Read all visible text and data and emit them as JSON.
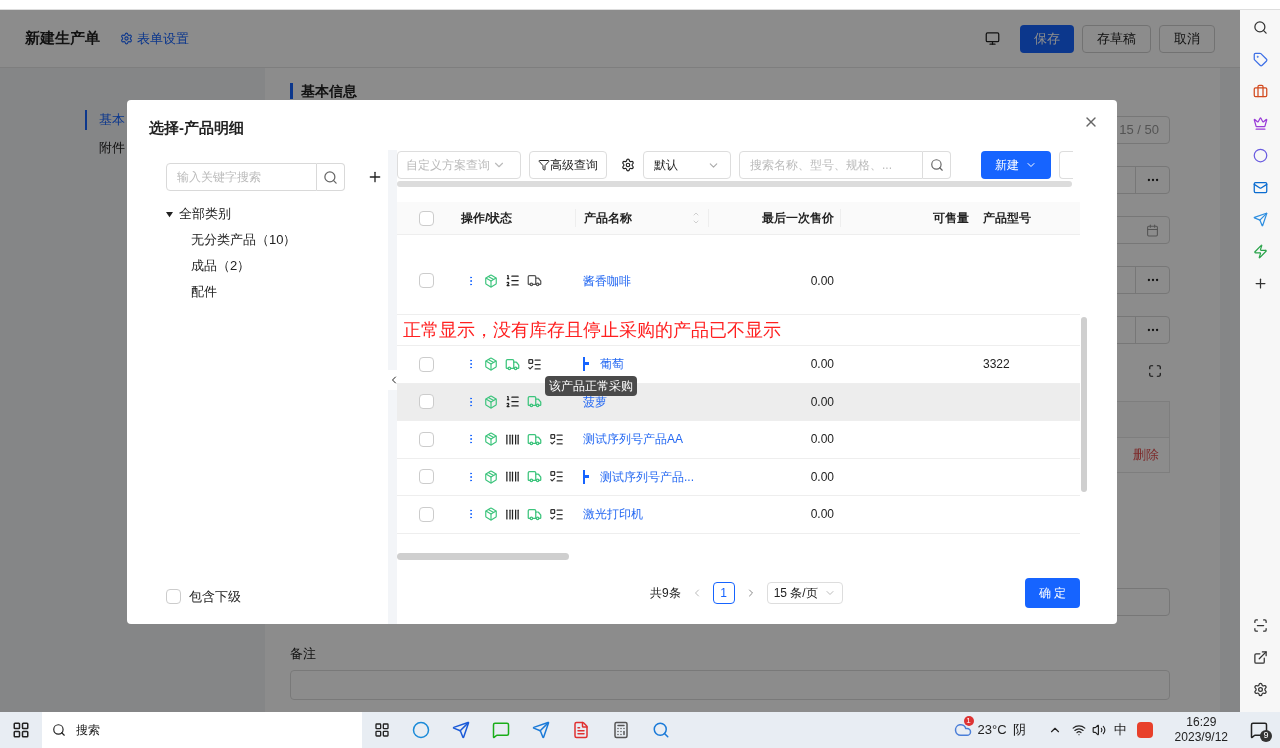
{
  "app": {
    "title": "新建生产单",
    "form_settings": "表单设置",
    "actions": [
      {
        "label": "保存",
        "primary": true
      },
      {
        "label": "存草稿",
        "primary": false
      },
      {
        "label": "取消",
        "primary": false
      }
    ],
    "nav": [
      {
        "label": "基本",
        "selected": true
      },
      {
        "label": "附件",
        "selected": false
      }
    ],
    "section_title": "基本信息",
    "counter": "15 / 50",
    "delete_link": "删除",
    "remark_label": "备注"
  },
  "dialog": {
    "title": "选择-产品明细",
    "tree_search_placeholder": "输入关键字搜索",
    "tree": [
      {
        "label": "全部类别",
        "expanded": true,
        "children": [
          {
            "label": "无分类产品（10）"
          },
          {
            "label": "成品（2）"
          },
          {
            "label": "配件"
          }
        ]
      }
    ],
    "include_sub": {
      "label": "包含下级",
      "checked": false
    },
    "toolbar": {
      "scheme_placeholder": "自定义方案查询",
      "advanced": "高级查询",
      "view": "默认",
      "search_placeholder": "搜索名称、型号、规格、...",
      "new": "新建"
    },
    "select_all": {
      "checked": false
    },
    "columns": [
      "操作/状态",
      "产品名称",
      "最后一次售价",
      "可售量",
      "产品型号"
    ],
    "rows": [
      {
        "checked": false,
        "name": "酱香咖啡",
        "icons": [
          {
            "kind": "box"
          },
          {
            "kind": "list"
          },
          {
            "kind": "truck"
          }
        ],
        "purchasing": false,
        "child": false,
        "hovered": false,
        "price": "0.00"
      },
      {
        "checked": false,
        "name": "葡萄",
        "icons": [
          {
            "kind": "box"
          },
          {
            "kind": "truck"
          },
          {
            "kind": "options"
          }
        ],
        "purchasing": true,
        "child": true,
        "hovered": false,
        "price": "0.00",
        "model": "3322"
      },
      {
        "checked": false,
        "name": "菠萝",
        "icons": [
          {
            "kind": "box"
          },
          {
            "kind": "list"
          },
          {
            "kind": "truck"
          }
        ],
        "purchasing": true,
        "child": false,
        "hovered": true,
        "price": "0.00"
      },
      {
        "checked": false,
        "name": "测试序列号产品AA",
        "icons": [
          {
            "kind": "box"
          },
          {
            "kind": "serial"
          },
          {
            "kind": "truck"
          },
          {
            "kind": "options"
          }
        ],
        "purchasing": true,
        "child": false,
        "hovered": false,
        "price": "0.00"
      },
      {
        "checked": false,
        "name": "测试序列号产品...",
        "icons": [
          {
            "kind": "box"
          },
          {
            "kind": "serial"
          },
          {
            "kind": "truck"
          },
          {
            "kind": "options"
          }
        ],
        "purchasing": true,
        "child": true,
        "hovered": false,
        "price": "0.00"
      },
      {
        "checked": false,
        "name": "激光打印机",
        "icons": [
          {
            "kind": "box"
          },
          {
            "kind": "serial"
          },
          {
            "kind": "truck"
          },
          {
            "kind": "options"
          }
        ],
        "purchasing": true,
        "child": false,
        "hovered": false,
        "price": "0.00"
      }
    ],
    "annotation": "正常显示，没有库存且停止采购的产品已不显示",
    "tooltip": "该产品正常采购",
    "pagination": {
      "total": "共9条",
      "pages": [
        {
          "label": "1",
          "selected": true
        }
      ],
      "page_size": "15 条/页"
    },
    "confirm": "确 定"
  },
  "taskbar": {
    "search": "搜索",
    "weather_badge": "1",
    "temperature": "23°C",
    "weather": "阴",
    "ime": "中",
    "time": "16:29",
    "date": "2023/9/12",
    "notifications": "9"
  }
}
